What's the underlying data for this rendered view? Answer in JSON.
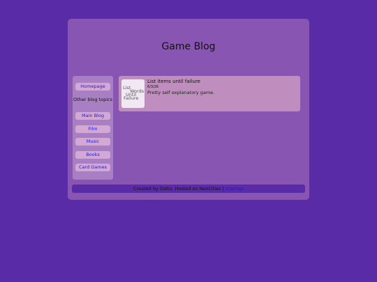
{
  "header": {
    "title": "Game Blog"
  },
  "sidebar": {
    "home_label": "Homepage",
    "heading": "Other blog topics",
    "items": [
      {
        "label": "Main Blog"
      },
      {
        "label": "Film"
      },
      {
        "label": "Music"
      },
      {
        "label": "Books"
      },
      {
        "label": "Card Games"
      }
    ]
  },
  "post": {
    "thumbnail_words": [
      "List",
      "Words",
      "Until",
      "Failure"
    ],
    "title": "List items until failure",
    "date": "6/3/26",
    "description": "Pretty self explanatory game."
  },
  "footer": {
    "text": "Created by Dalto, Hosted on NeoCities |",
    "link": "sitemap"
  }
}
